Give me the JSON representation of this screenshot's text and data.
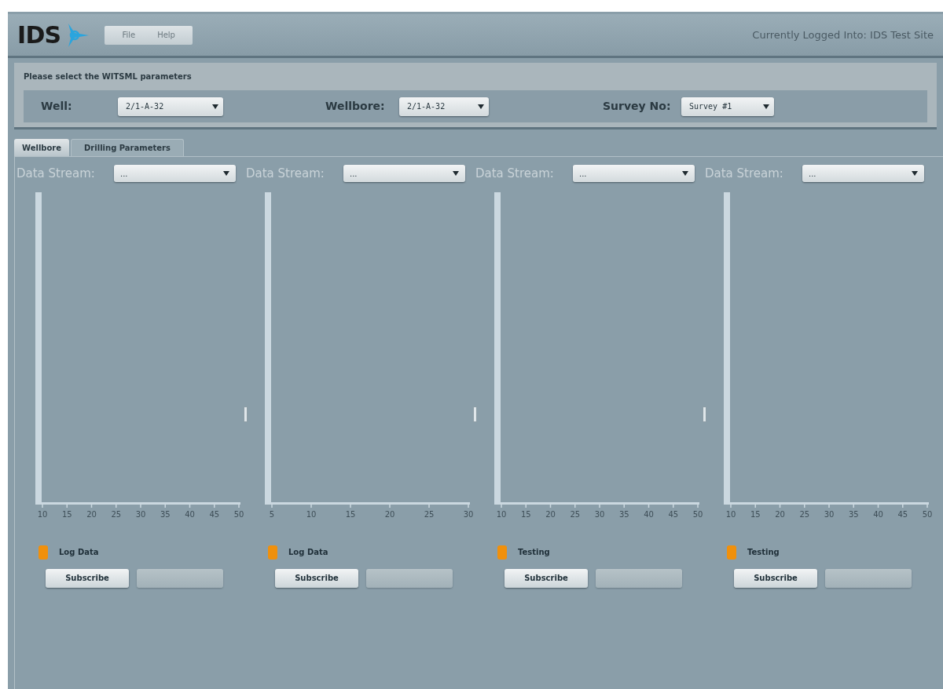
{
  "header": {
    "logo": "IDS",
    "menu": [
      "File",
      "Help"
    ],
    "login_status": "Currently Logged Into: IDS Test Site"
  },
  "parameters": {
    "title": "Please select the WITSML parameters",
    "fields": [
      {
        "label": "Well:",
        "value": "2/1-A-32"
      },
      {
        "label": "Wellbore:",
        "value": "2/1-A-32"
      },
      {
        "label": "Survey No:",
        "value": "Survey #1"
      }
    ]
  },
  "tabs": [
    {
      "label": "Wellbore",
      "selected": true
    },
    {
      "label": "Drilling Parameters",
      "selected": false
    }
  ],
  "panels": [
    {
      "stream_label": "Data Stream:",
      "stream_value": "...",
      "x_ticks": [
        "10",
        "15",
        "20",
        "25",
        "30",
        "35",
        "40",
        "45",
        "50"
      ],
      "legend": {
        "label": "Log Data",
        "color": "#f0900c"
      },
      "subscribe_button": "Subscribe"
    },
    {
      "stream_label": "Data Stream:",
      "stream_value": "...",
      "x_ticks": [
        "5",
        "10",
        "15",
        "20",
        "25",
        "30"
      ],
      "legend": {
        "label": "Log Data",
        "color": "#f0900c"
      },
      "subscribe_button": "Subscribe"
    },
    {
      "stream_label": "Data Stream:",
      "stream_value": "...",
      "x_ticks": [
        "10",
        "15",
        "20",
        "25",
        "30",
        "35",
        "40",
        "45",
        "50"
      ],
      "legend": {
        "label": "Testing",
        "color": "#f0900c"
      },
      "subscribe_button": "Subscribe"
    },
    {
      "stream_label": "Data Stream:",
      "stream_value": "...",
      "x_ticks": [
        "10",
        "15",
        "20",
        "25",
        "30",
        "35",
        "40",
        "45",
        "50"
      ],
      "legend": {
        "label": "Testing",
        "color": "#f0900c"
      },
      "subscribe_button": "Subscribe"
    }
  ]
}
